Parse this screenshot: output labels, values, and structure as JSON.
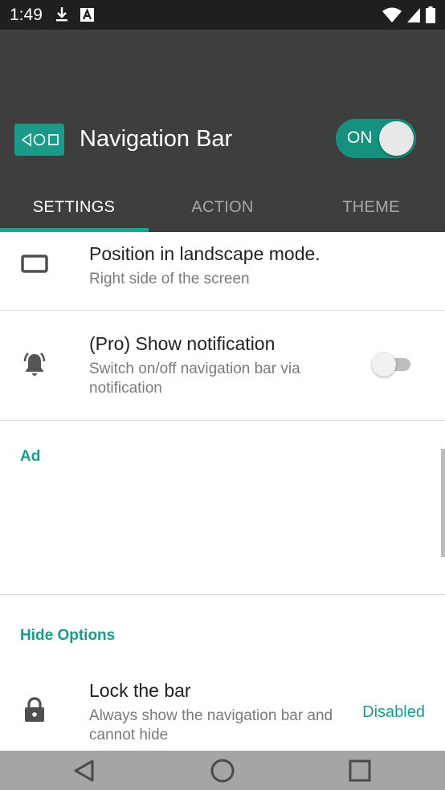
{
  "status_bar": {
    "time": "1:49",
    "left_icons": [
      "download-icon",
      "font-a-icon"
    ],
    "right_icons": [
      "wifi-icon",
      "signal-icon",
      "battery-icon"
    ]
  },
  "header": {
    "title": "Navigation Bar",
    "switch_label": "ON",
    "switch_on": true,
    "accent_color": "#17917f"
  },
  "tabs": [
    {
      "label": "SETTINGS",
      "active": true
    },
    {
      "label": "ACTION",
      "active": false
    },
    {
      "label": "THEME",
      "active": false
    }
  ],
  "settings": {
    "landscape": {
      "title": "Position in landscape mode.",
      "subtitle": "Right side of the screen",
      "icon": "rectangle-icon"
    },
    "notification": {
      "title": "(Pro) Show notification",
      "subtitle": "Switch on/off navigation bar via notification",
      "icon": "bell-ring-icon",
      "enabled": false
    },
    "ad_section": {
      "label": "Ad"
    },
    "hide_section": {
      "label": "Hide Options"
    },
    "lock": {
      "title": "Lock the bar",
      "subtitle": "Always show the navigation bar and cannot hide",
      "value": "Disabled",
      "icon": "lock-icon"
    }
  },
  "nav_bar": {
    "buttons": [
      "back-icon",
      "home-icon",
      "recents-icon"
    ]
  }
}
